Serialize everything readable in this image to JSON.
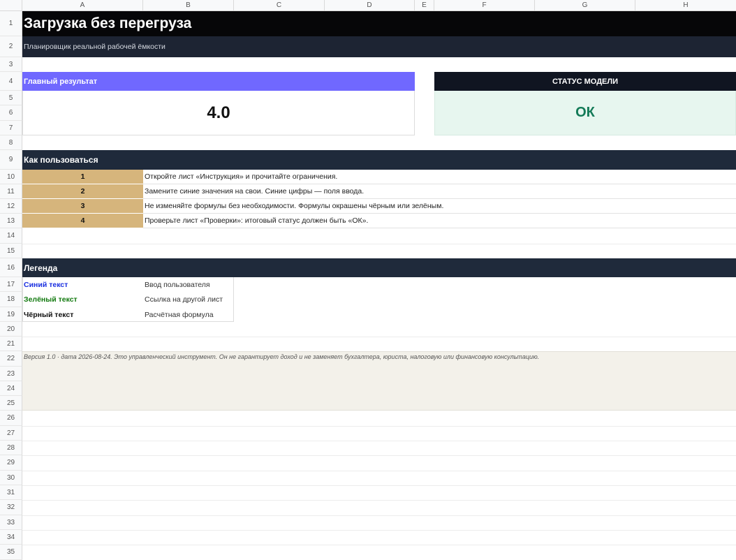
{
  "columns": [
    "A",
    "B",
    "C",
    "D",
    "E",
    "F",
    "G",
    "H"
  ],
  "rows": [
    "1",
    "2",
    "3",
    "4",
    "5",
    "6",
    "7",
    "8",
    "9",
    "10",
    "11",
    "12",
    "13",
    "14",
    "15",
    "16",
    "17",
    "18",
    "19",
    "20",
    "21",
    "22",
    "23",
    "24",
    "25",
    "26",
    "27",
    "28",
    "29",
    "30",
    "31",
    "32",
    "33",
    "34",
    "35"
  ],
  "title": "Загрузка без перегруза",
  "subtitle": "Планировщик реальной рабочей ёмкости",
  "main_result": {
    "label": "Главный результат",
    "value": "4.0"
  },
  "status": {
    "label": "СТАТУС МОДЕЛИ",
    "value": "ОК"
  },
  "how_to": {
    "title": "Как пользоваться",
    "steps": [
      {
        "num": "1",
        "text": "Откройте лист «Инструкция» и прочитайте ограничения."
      },
      {
        "num": "2",
        "text": "Замените синие значения на свои. Синие цифры — поля ввода."
      },
      {
        "num": "3",
        "text": "Не изменяйте формулы без необходимости. Формулы окрашены чёрным или зелёным."
      },
      {
        "num": "4",
        "text": "Проверьте лист «Проверки»: итоговый статус должен быть «ОК»."
      }
    ]
  },
  "legend": {
    "title": "Легенда",
    "items": [
      {
        "key": "Синий текст",
        "value": "Ввод пользователя",
        "color": "#1a2fe0"
      },
      {
        "key": "Зелёный текст",
        "value": "Ссылка на другой лист",
        "color": "#137a10"
      },
      {
        "key": "Чёрный текст",
        "value": "Расчётная формула",
        "color": "#111111"
      }
    ]
  },
  "footer": "Версия 1.0 · дата 2026-08-24. Это управленческий инструмент. Он не гарантирует доход и не заменяет бухгалтера, юриста, налоговую или финансовую консультацию.",
  "colors": {
    "title_band": "#060608",
    "result_header": "#7068ff",
    "status_value": "#137a57",
    "step_number_fill": "#d6b57c",
    "footer_fill": "#f3f1ea"
  }
}
